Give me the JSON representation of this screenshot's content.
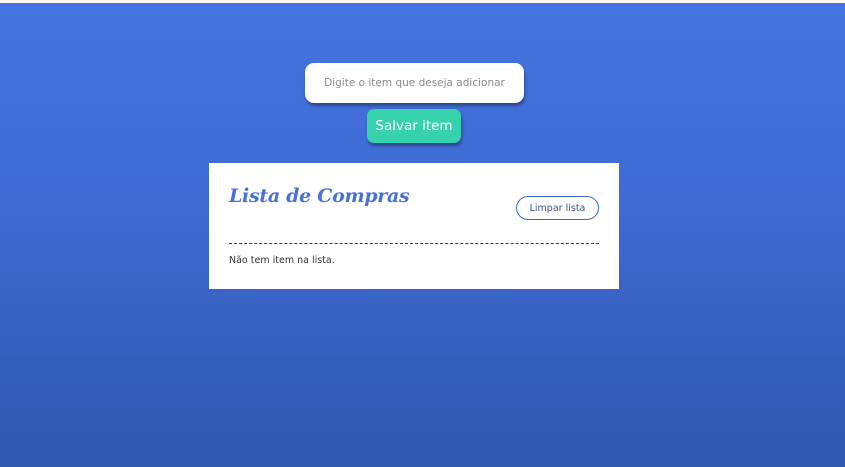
{
  "form": {
    "input_placeholder": "Digite o item que deseja adicionar",
    "input_value": "",
    "save_label": "Salvar item"
  },
  "list": {
    "title": "Lista de Compras",
    "clear_label": "Limpar lista",
    "empty_message": "Não tem item na lista."
  },
  "colors": {
    "background_top": "#4574e0",
    "background_bottom": "#2f57ae",
    "save_button": "#35d2ad",
    "title": "#4672d6",
    "divider": "#1c2bb0"
  }
}
